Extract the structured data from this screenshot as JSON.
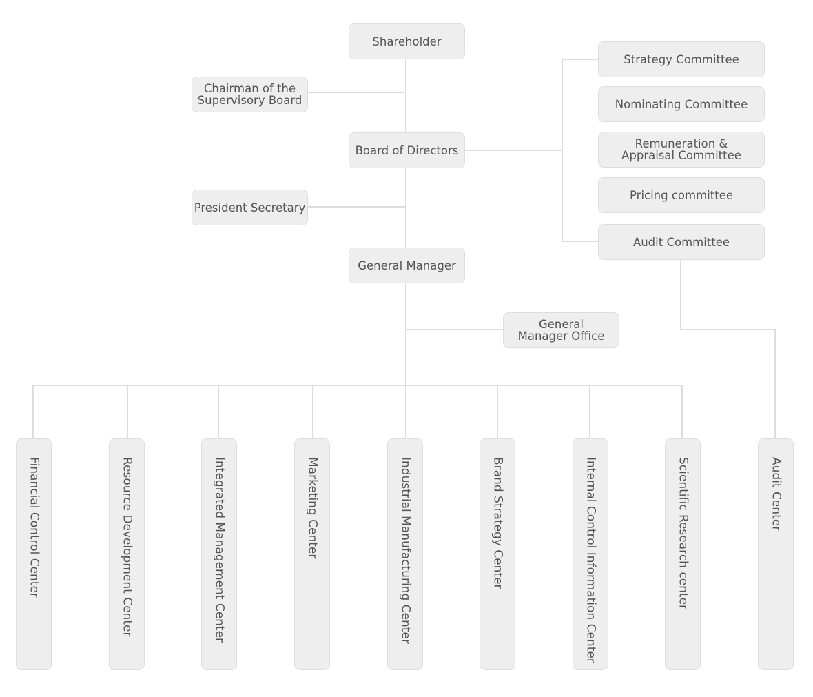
{
  "diagram": {
    "type": "org-chart",
    "colors": {
      "node_fill": "#eeeeee",
      "node_border": "#dedede",
      "text": "#555555",
      "connector": "#dddddd"
    },
    "nodes": {
      "shareholder": "Shareholder",
      "chairman_supervisory": "Chairman of the\nSupervisory Board",
      "board_of_directors": "Board of Directors",
      "president_secretary": "President Secretary",
      "general_manager": "General Manager",
      "general_manager_office": "General\nManager Office",
      "committees": [
        "Strategy Committee",
        "Nominating Committee",
        "Remuneration &\nAppraisal Committee",
        "Pricing committee",
        "Audit Committee"
      ],
      "centers": [
        "Financial Control Center",
        "Resource Development Center",
        "Integrated Management Center",
        "Marketing Center",
        "Industrial Manufacturing Center",
        "Brand Strategy Center",
        "Internal Control Information Center",
        "Scientific Research center",
        "Audit Center"
      ]
    },
    "edges": [
      [
        "Shareholder",
        "Board of Directors"
      ],
      [
        "Shareholder",
        "Chairman of the Supervisory Board"
      ],
      [
        "Board of Directors",
        "General Manager"
      ],
      [
        "Board of Directors",
        "President Secretary"
      ],
      [
        "Board of Directors",
        "Strategy Committee"
      ],
      [
        "Board of Directors",
        "Nominating Committee"
      ],
      [
        "Board of Directors",
        "Remuneration & Appraisal Committee"
      ],
      [
        "Board of Directors",
        "Pricing committee"
      ],
      [
        "Board of Directors",
        "Audit Committee"
      ],
      [
        "General Manager",
        "General Manager Office"
      ],
      [
        "General Manager",
        "Financial Control Center"
      ],
      [
        "General Manager",
        "Resource Development Center"
      ],
      [
        "General Manager",
        "Integrated Management Center"
      ],
      [
        "General Manager",
        "Marketing Center"
      ],
      [
        "General Manager",
        "Industrial Manufacturing Center"
      ],
      [
        "General Manager",
        "Brand Strategy Center"
      ],
      [
        "General Manager",
        "Internal Control Information Center"
      ],
      [
        "General Manager",
        "Scientific Research center"
      ],
      [
        "Audit Committee",
        "Audit Center"
      ]
    ]
  }
}
